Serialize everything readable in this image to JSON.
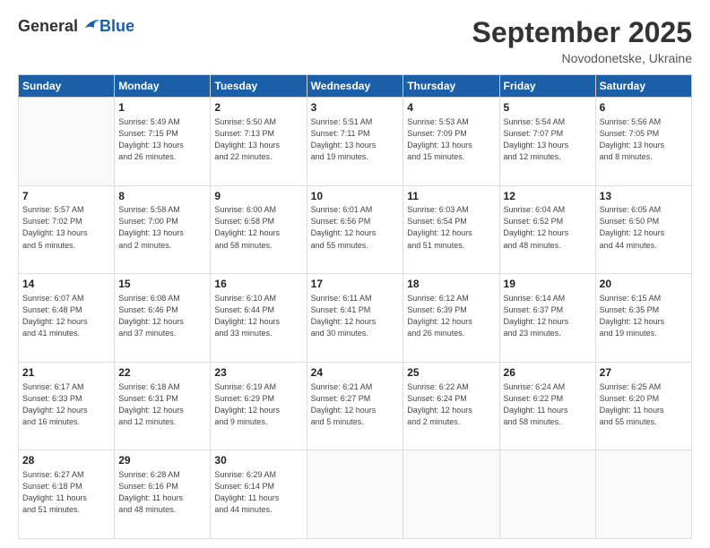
{
  "header": {
    "logo_general": "General",
    "logo_blue": "Blue",
    "month_title": "September 2025",
    "location": "Novodonetske, Ukraine"
  },
  "weekdays": [
    "Sunday",
    "Monday",
    "Tuesday",
    "Wednesday",
    "Thursday",
    "Friday",
    "Saturday"
  ],
  "weeks": [
    [
      {
        "day": "",
        "info": ""
      },
      {
        "day": "1",
        "info": "Sunrise: 5:49 AM\nSunset: 7:15 PM\nDaylight: 13 hours\nand 26 minutes."
      },
      {
        "day": "2",
        "info": "Sunrise: 5:50 AM\nSunset: 7:13 PM\nDaylight: 13 hours\nand 22 minutes."
      },
      {
        "day": "3",
        "info": "Sunrise: 5:51 AM\nSunset: 7:11 PM\nDaylight: 13 hours\nand 19 minutes."
      },
      {
        "day": "4",
        "info": "Sunrise: 5:53 AM\nSunset: 7:09 PM\nDaylight: 13 hours\nand 15 minutes."
      },
      {
        "day": "5",
        "info": "Sunrise: 5:54 AM\nSunset: 7:07 PM\nDaylight: 13 hours\nand 12 minutes."
      },
      {
        "day": "6",
        "info": "Sunrise: 5:56 AM\nSunset: 7:05 PM\nDaylight: 13 hours\nand 8 minutes."
      }
    ],
    [
      {
        "day": "7",
        "info": "Sunrise: 5:57 AM\nSunset: 7:02 PM\nDaylight: 13 hours\nand 5 minutes."
      },
      {
        "day": "8",
        "info": "Sunrise: 5:58 AM\nSunset: 7:00 PM\nDaylight: 13 hours\nand 2 minutes."
      },
      {
        "day": "9",
        "info": "Sunrise: 6:00 AM\nSunset: 6:58 PM\nDaylight: 12 hours\nand 58 minutes."
      },
      {
        "day": "10",
        "info": "Sunrise: 6:01 AM\nSunset: 6:56 PM\nDaylight: 12 hours\nand 55 minutes."
      },
      {
        "day": "11",
        "info": "Sunrise: 6:03 AM\nSunset: 6:54 PM\nDaylight: 12 hours\nand 51 minutes."
      },
      {
        "day": "12",
        "info": "Sunrise: 6:04 AM\nSunset: 6:52 PM\nDaylight: 12 hours\nand 48 minutes."
      },
      {
        "day": "13",
        "info": "Sunrise: 6:05 AM\nSunset: 6:50 PM\nDaylight: 12 hours\nand 44 minutes."
      }
    ],
    [
      {
        "day": "14",
        "info": "Sunrise: 6:07 AM\nSunset: 6:48 PM\nDaylight: 12 hours\nand 41 minutes."
      },
      {
        "day": "15",
        "info": "Sunrise: 6:08 AM\nSunset: 6:46 PM\nDaylight: 12 hours\nand 37 minutes."
      },
      {
        "day": "16",
        "info": "Sunrise: 6:10 AM\nSunset: 6:44 PM\nDaylight: 12 hours\nand 33 minutes."
      },
      {
        "day": "17",
        "info": "Sunrise: 6:11 AM\nSunset: 6:41 PM\nDaylight: 12 hours\nand 30 minutes."
      },
      {
        "day": "18",
        "info": "Sunrise: 6:12 AM\nSunset: 6:39 PM\nDaylight: 12 hours\nand 26 minutes."
      },
      {
        "day": "19",
        "info": "Sunrise: 6:14 AM\nSunset: 6:37 PM\nDaylight: 12 hours\nand 23 minutes."
      },
      {
        "day": "20",
        "info": "Sunrise: 6:15 AM\nSunset: 6:35 PM\nDaylight: 12 hours\nand 19 minutes."
      }
    ],
    [
      {
        "day": "21",
        "info": "Sunrise: 6:17 AM\nSunset: 6:33 PM\nDaylight: 12 hours\nand 16 minutes."
      },
      {
        "day": "22",
        "info": "Sunrise: 6:18 AM\nSunset: 6:31 PM\nDaylight: 12 hours\nand 12 minutes."
      },
      {
        "day": "23",
        "info": "Sunrise: 6:19 AM\nSunset: 6:29 PM\nDaylight: 12 hours\nand 9 minutes."
      },
      {
        "day": "24",
        "info": "Sunrise: 6:21 AM\nSunset: 6:27 PM\nDaylight: 12 hours\nand 5 minutes."
      },
      {
        "day": "25",
        "info": "Sunrise: 6:22 AM\nSunset: 6:24 PM\nDaylight: 12 hours\nand 2 minutes."
      },
      {
        "day": "26",
        "info": "Sunrise: 6:24 AM\nSunset: 6:22 PM\nDaylight: 11 hours\nand 58 minutes."
      },
      {
        "day": "27",
        "info": "Sunrise: 6:25 AM\nSunset: 6:20 PM\nDaylight: 11 hours\nand 55 minutes."
      }
    ],
    [
      {
        "day": "28",
        "info": "Sunrise: 6:27 AM\nSunset: 6:18 PM\nDaylight: 11 hours\nand 51 minutes."
      },
      {
        "day": "29",
        "info": "Sunrise: 6:28 AM\nSunset: 6:16 PM\nDaylight: 11 hours\nand 48 minutes."
      },
      {
        "day": "30",
        "info": "Sunrise: 6:29 AM\nSunset: 6:14 PM\nDaylight: 11 hours\nand 44 minutes."
      },
      {
        "day": "",
        "info": ""
      },
      {
        "day": "",
        "info": ""
      },
      {
        "day": "",
        "info": ""
      },
      {
        "day": "",
        "info": ""
      }
    ]
  ]
}
